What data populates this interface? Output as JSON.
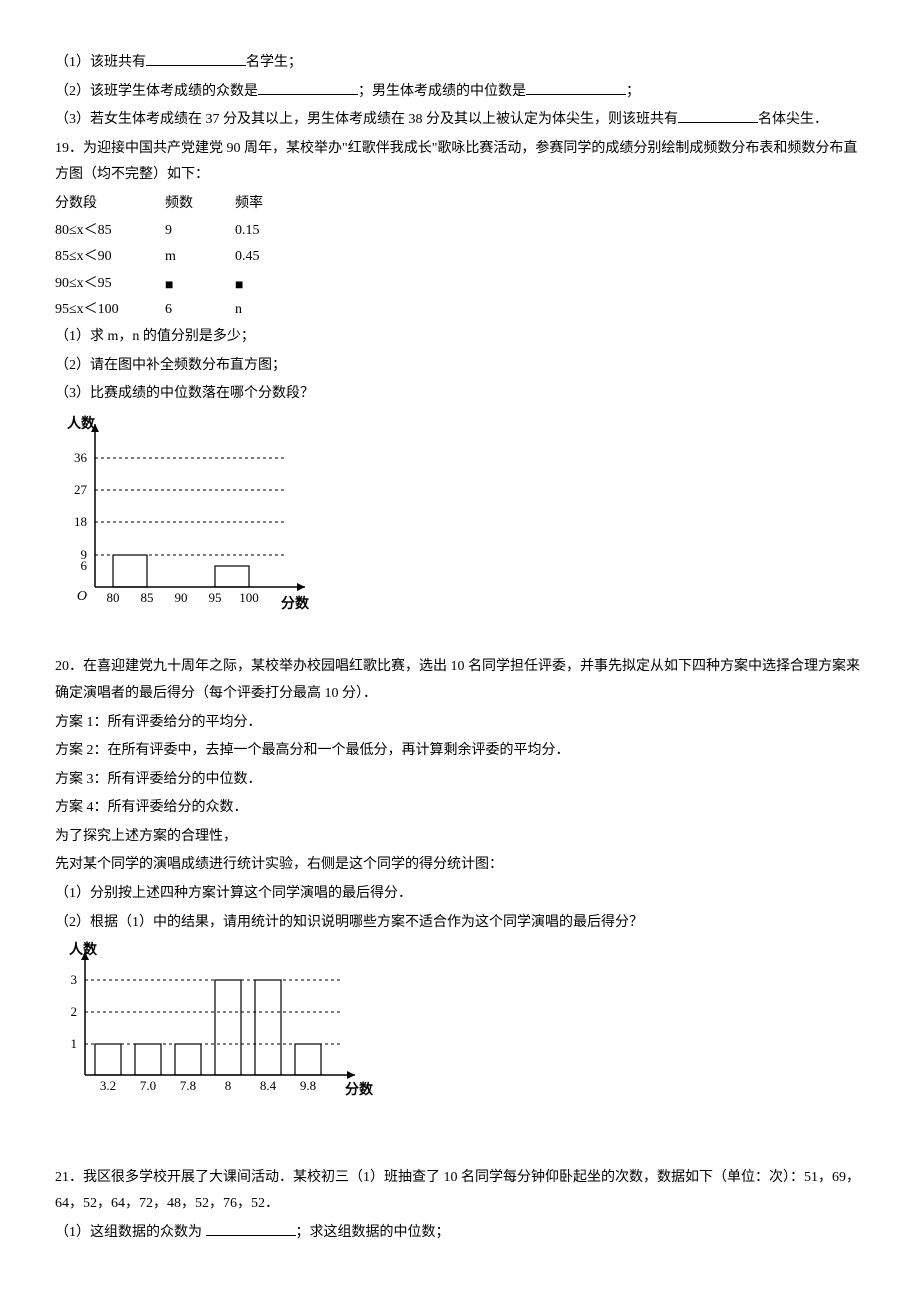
{
  "q18": {
    "l1_a": "（1）该班共有",
    "l1_b": "名学生；",
    "l2_a": "（2）该班学生体考成绩的众数是",
    "l2_b": "；男生体考成绩的中位数是",
    "l2_c": "；",
    "l3_a": "（3）若女生体考成绩在 37 分及其以上，男生体考成绩在 38 分及其以上被认定为体尖生，则该班共有",
    "l3_b": "名体尖生．"
  },
  "q19": {
    "intro": "19．为迎接中国共产党建党 90 周年，某校举办\"红歌伴我成长\"歌咏比赛活动，参赛同学的成绩分别绘制成频数分布表和频数分布直方图（均不完整）如下：",
    "header_c1": "分数段",
    "header_c2": "频数",
    "header_c3": "频率",
    "r1_c1": "80≤x＜85",
    "r1_c2": "9",
    "r1_c3": "0.15",
    "r2_c1": "85≤x＜90",
    "r2_c2": "m",
    "r2_c3": "0.45",
    "r3_c1": "90≤x＜95",
    "r3_c2": "■",
    "r3_c3": "■",
    "r4_c1": "95≤x＜100",
    "r4_c2": "6",
    "r4_c3": "n",
    "sub1": "（1）求 m，n 的值分别是多少；",
    "sub2": "（2）请在图中补全频数分布直方图；",
    "sub3": "（3）比赛成绩的中位数落在哪个分数段？",
    "chart": {
      "ylabel": "人数",
      "xlabel": "分数",
      "y_ticks": [
        "36",
        "27",
        "18",
        "9",
        "6"
      ],
      "x_ticks": [
        "80",
        "85",
        "90",
        "95",
        "100"
      ]
    }
  },
  "q20": {
    "intro": "20．在喜迎建党九十周年之际，某校举办校园唱红歌比赛，选出 10 名同学担任评委，并事先拟定从如下四种方案中选择合理方案来确定演唱者的最后得分（每个评委打分最高 10 分）．",
    "p1": "方案 1：所有评委给分的平均分．",
    "p2": "方案 2：在所有评委中，去掉一个最高分和一个最低分，再计算剩余评委的平均分．",
    "p3": "方案 3：所有评委给分的中位数．",
    "p4": "方案 4：所有评委给分的众数．",
    "p5": "为了探究上述方案的合理性，",
    "p6": "先对某个同学的演唱成绩进行统计实验，右侧是这个同学的得分统计图：",
    "sub1": "（1）分别按上述四种方案计算这个同学演唱的最后得分．",
    "sub2": "（2）根据（1）中的结果，请用统计的知识说明哪些方案不适合作为这个同学演唱的最后得分？",
    "chart": {
      "ylabel": "人数",
      "xlabel": "分数",
      "y_ticks": [
        "3",
        "2",
        "1"
      ],
      "x_ticks": [
        "3.2",
        "7.0",
        "7.8",
        "8",
        "8.4",
        "9.8"
      ]
    }
  },
  "q21": {
    "intro": "21．我区很多学校开展了大课间活动．某校初三（1）班抽查了 10 名同学每分钟仰卧起坐的次数，数据如下（单位：次）：51，69，64，52，64，72，48，52，76，52．",
    "sub1_a": "（1）这组数据的众数为 ",
    "sub1_b": "；求这组数据的中位数；"
  },
  "chart_data": [
    {
      "type": "bar",
      "title": "频数分布直方图",
      "categories": [
        "80-85",
        "85-90",
        "90-95",
        "95-100"
      ],
      "values": [
        9,
        null,
        null,
        6
      ],
      "xlabel": "分数",
      "ylabel": "人数",
      "ylim": [
        0,
        40
      ],
      "y_ticks": [
        6,
        9,
        18,
        27,
        36
      ]
    },
    {
      "type": "bar",
      "title": "得分统计图",
      "categories": [
        "3.2",
        "7.0",
        "7.8",
        "8",
        "8.4",
        "9.8"
      ],
      "values": [
        1,
        1,
        1,
        3,
        3,
        1
      ],
      "xlabel": "分数",
      "ylabel": "人数",
      "ylim": [
        0,
        3.5
      ],
      "y_ticks": [
        1,
        2,
        3
      ]
    }
  ]
}
